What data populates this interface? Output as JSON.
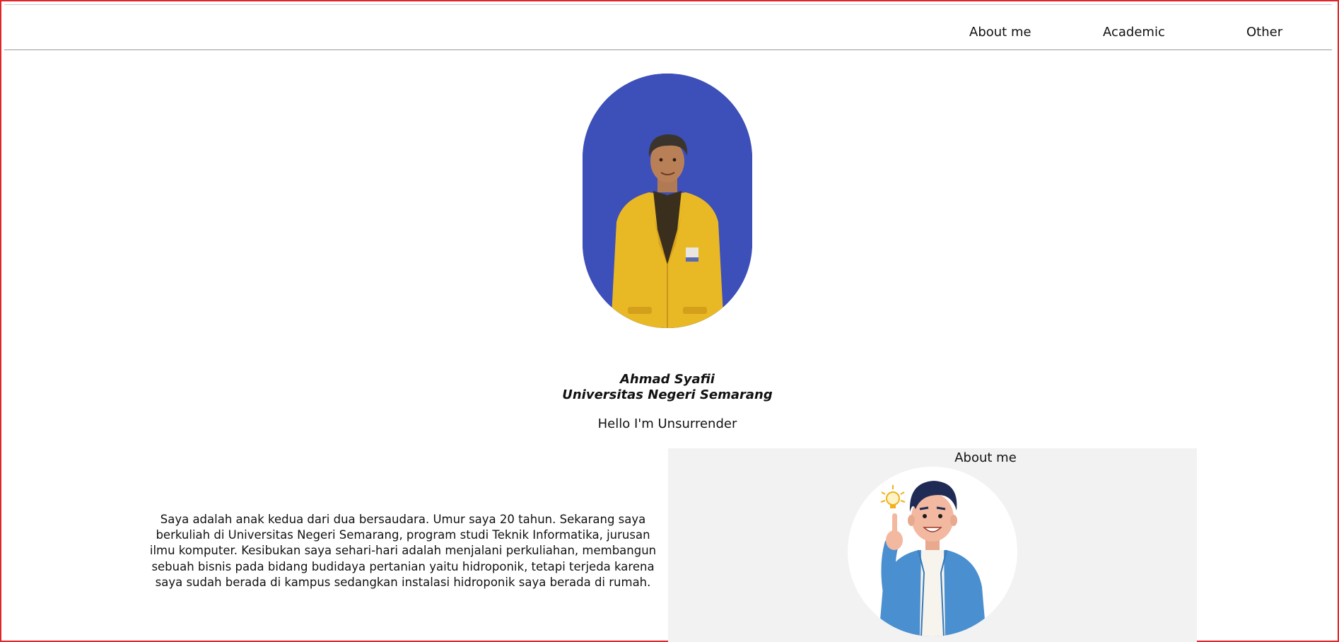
{
  "nav": {
    "items": [
      "About me",
      "Academic",
      "Other"
    ]
  },
  "profile": {
    "name": "Ahmad Syafii",
    "university": "Universitas Negeri Semarang",
    "tagline": "Hello I'm Unsurrender"
  },
  "about": {
    "title": "About me",
    "text": "Saya adalah anak kedua dari dua bersaudara. Umur saya 20 tahun. Sekarang saya berkuliah di Universitas Negeri Semarang, program studi Teknik Informatika, jurusan ilmu komputer. Kesibukan saya sehari-hari adalah menjalani perkuliahan, membangun sebuah bisnis pada bidang budidaya pertanian yaitu hidroponik, tetapi terjeda karena saya sudah berada di kampus sedangkan instalasi hidroponik saya berada di rumah."
  },
  "colors": {
    "frame_border": "#e0262b",
    "photo_background": "#3d4fb8",
    "jacket": "#e9b825",
    "about_panel_bg": "#f2f2f2",
    "illustration_jacket": "#4a8fd0"
  },
  "icons": {
    "idea": "lightbulb-icon"
  }
}
